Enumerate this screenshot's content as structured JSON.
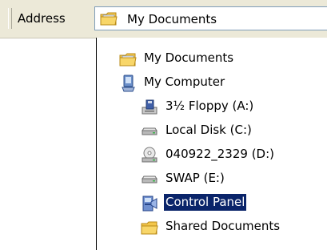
{
  "address_bar": {
    "label": "Address",
    "value": "My Documents",
    "icon": "my-documents-folder-icon"
  },
  "dropdown": {
    "items": [
      {
        "label": "My Documents",
        "icon": "my-documents-folder-icon",
        "selected": false
      },
      {
        "label": "My Computer",
        "icon": "my-computer-icon",
        "selected": false
      },
      {
        "label": "3½ Floppy (A:)",
        "icon": "floppy-drive-icon",
        "selected": false
      },
      {
        "label": "Local Disk (C:)",
        "icon": "hard-disk-icon",
        "selected": false
      },
      {
        "label": "040922_2329 (D:)",
        "icon": "cd-drive-icon",
        "selected": false
      },
      {
        "label": "SWAP (E:)",
        "icon": "hard-disk-icon",
        "selected": false
      },
      {
        "label": "Control Panel",
        "icon": "control-panel-icon",
        "selected": true
      },
      {
        "label": "Shared Documents",
        "icon": "folder-icon",
        "selected": false
      }
    ]
  },
  "colors": {
    "toolbar_bg": "#ece9d8",
    "selection_bg": "#0a246a",
    "selection_text": "#ffffff"
  }
}
